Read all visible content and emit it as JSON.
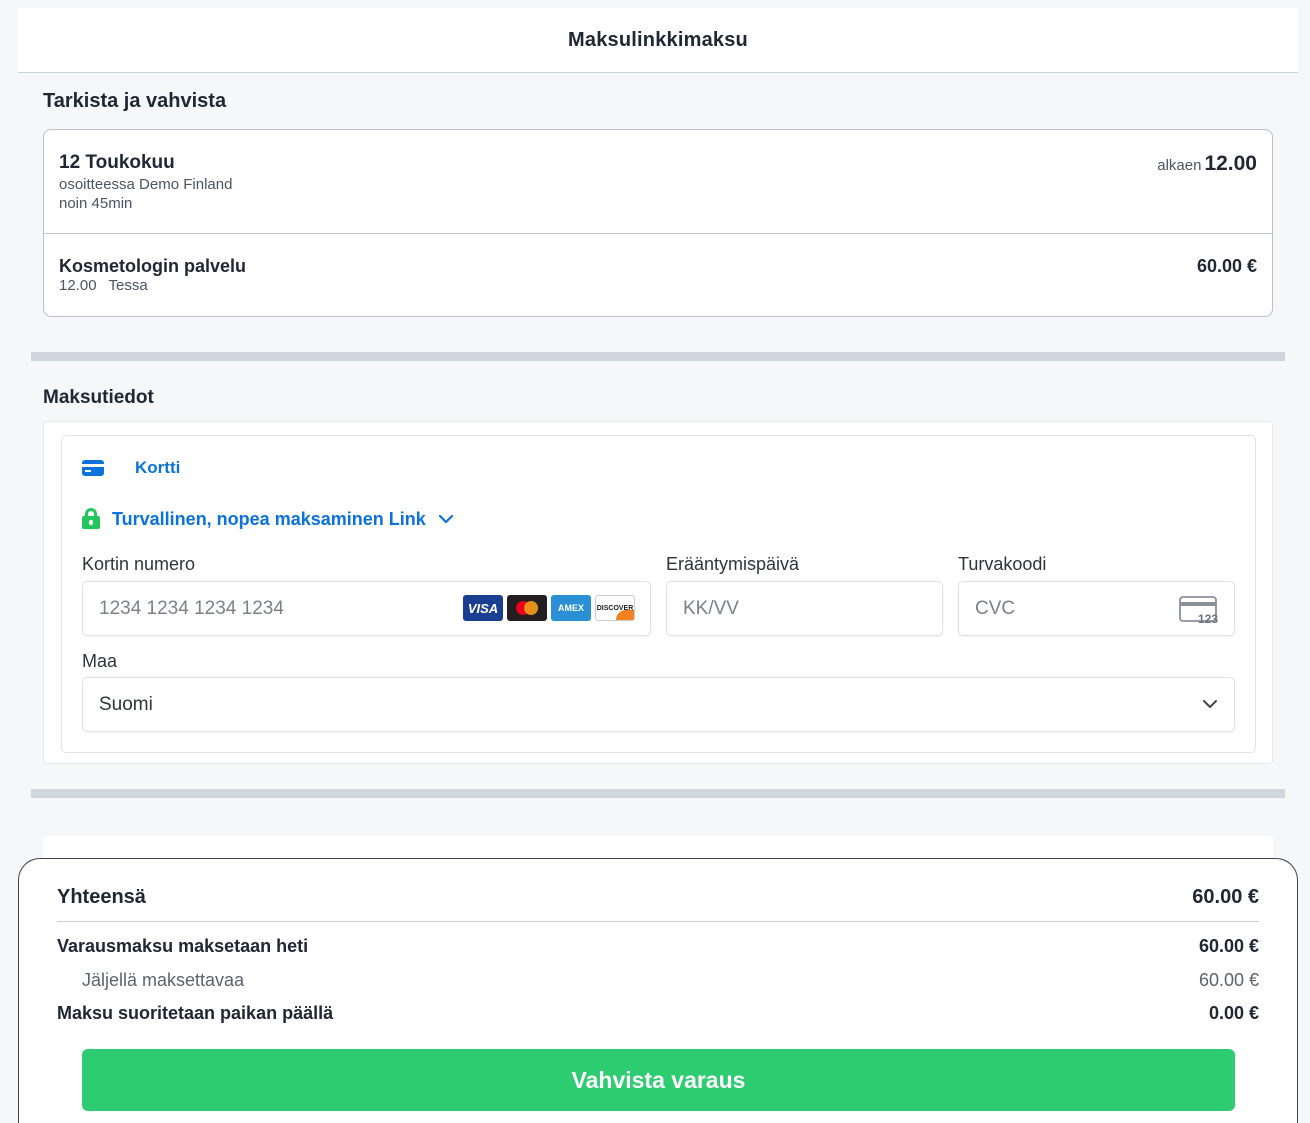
{
  "header": {
    "title": "Maksulinkkimaksu"
  },
  "review": {
    "title": "Tarkista ja vahvista",
    "date": "12 Toukokuu",
    "address": "osoitteessa Demo Finland",
    "duration": "noin 45min",
    "from_label": "alkaen",
    "from_time": "12.00",
    "service": {
      "name": "Kosmetologin palvelu",
      "time": "12.00",
      "staff": "Tessa",
      "price": "60.00 €"
    }
  },
  "payment": {
    "title": "Maksutiedot",
    "tab_label": "Kortti",
    "link_label": "Turvallinen, nopea maksaminen Link",
    "card_number": {
      "label": "Kortin numero",
      "placeholder": "1234 1234 1234 1234"
    },
    "expiry": {
      "label": "Erääntymispäivä",
      "placeholder": "KK/VV"
    },
    "cvc": {
      "label": "Turvakoodi",
      "placeholder": "CVC"
    },
    "country": {
      "label": "Maa",
      "value": "Suomi"
    },
    "brands": {
      "visa": "VISA",
      "amex": "AMEX",
      "discover": "DISCOVER"
    },
    "cvc_icon_text": "123"
  },
  "summary": {
    "total_label": "Yhteensä",
    "total_value": "60.00 €",
    "deposit_label": "Varausmaksu maksetaan heti",
    "deposit_value": "60.00 €",
    "remaining_label": "Jäljellä maksettavaa",
    "remaining_value": "60.00 €",
    "onsite_label": "Maksu suoritetaan paikan päällä",
    "onsite_value": "0.00 €",
    "confirm_label": "Vahvista varaus"
  },
  "colors": {
    "accent": "#0a72d9",
    "success": "#2ecc71",
    "lock": "#22c55e"
  }
}
